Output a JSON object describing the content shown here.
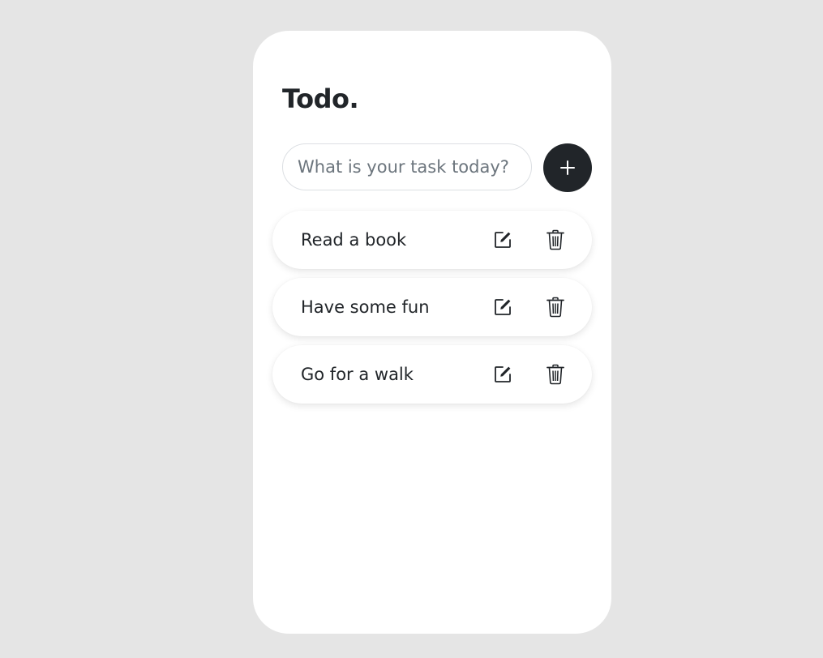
{
  "app": {
    "title": "Todo."
  },
  "new_task": {
    "placeholder": "What is your task today?",
    "value": "",
    "add_icon": "plus-icon"
  },
  "todos": [
    {
      "label": "Read a book",
      "edit_icon": "edit-icon",
      "delete_icon": "trash-icon"
    },
    {
      "label": "Have some fun",
      "edit_icon": "edit-icon",
      "delete_icon": "trash-icon"
    },
    {
      "label": "Go for a walk",
      "edit_icon": "edit-icon",
      "delete_icon": "trash-icon"
    }
  ],
  "colors": {
    "background": "#e5e5e5",
    "card": "#ffffff",
    "primary": "#212529",
    "placeholder": "#6c757d"
  }
}
